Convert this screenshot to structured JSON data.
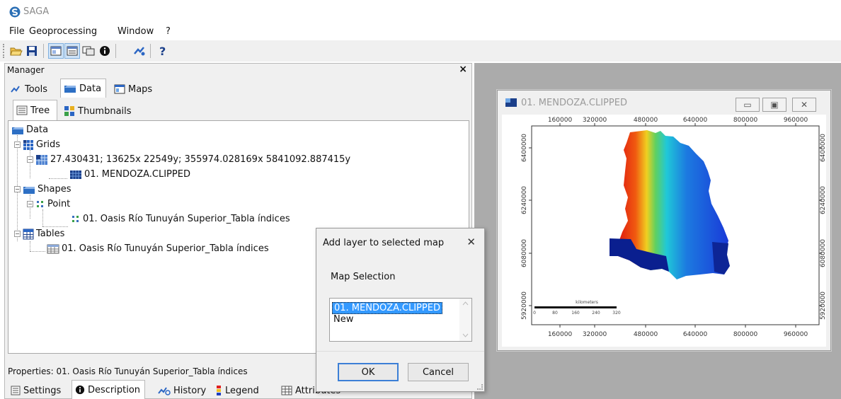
{
  "app": {
    "title": "SAGA",
    "logo_icon": "saga-logo-icon"
  },
  "menu": [
    "File",
    "Geoprocessing",
    "Window",
    "?"
  ],
  "toolbar": {
    "buttons": [
      "open-icon",
      "save-icon",
      "workspace-icon",
      "grid-view-icon",
      "table-view-icon",
      "info-icon",
      "tools-icon",
      "help-icon"
    ]
  },
  "manager": {
    "title": "Manager",
    "close_glyph": "×",
    "tabs": [
      "Tools",
      "Data",
      "Maps"
    ],
    "active_tab": "Data",
    "subtabs": [
      "Tree",
      "Thumbnails"
    ],
    "active_subtab": "Tree",
    "tree": {
      "root": "Data",
      "grids": "Grids",
      "grid_system": "27.430431; 13625x 22549y; 355974.028169x 5841092.887415y",
      "grid_item": "01. MENDOZA.CLIPPED",
      "shapes": "Shapes",
      "point": "Point",
      "shape_item": "01. Oasis Río Tunuyán Superior_Tabla índices",
      "tables": "Tables",
      "table_item": "01. Oasis Río Tunuyán Superior_Tabla índices"
    },
    "properties_label": "Properties: 01. Oasis Río Tunuyán Superior_Tabla índices",
    "bottom_tabs": [
      "Settings",
      "Description",
      "History",
      "Legend",
      "Attributes"
    ],
    "active_bottom_tab": "Description"
  },
  "map_window": {
    "title": "01. MENDOZA.CLIPPED",
    "controls": [
      "minimize",
      "maximize",
      "close"
    ],
    "x_ticks": [
      "160000",
      "320000",
      "480000",
      "640000",
      "800000",
      "960000"
    ],
    "y_ticks": [
      "6400000",
      "6240000",
      "6080000",
      "5920000"
    ],
    "scalebar_ticks": [
      "0",
      "80",
      "160",
      "240",
      "320"
    ],
    "scalebar_unit": "kilometers"
  },
  "dialog": {
    "title": "Add layer to selected map",
    "close_glyph": "✕",
    "label": "Map Selection",
    "options": [
      "01. MENDOZA.CLIPPED",
      "New"
    ],
    "selected": "01. MENDOZA.CLIPPED",
    "ok": "OK",
    "cancel": "Cancel"
  },
  "colors": {
    "selection": "#3399ff",
    "mdi_background": "#ababab",
    "panel": "#f0f0f0"
  }
}
